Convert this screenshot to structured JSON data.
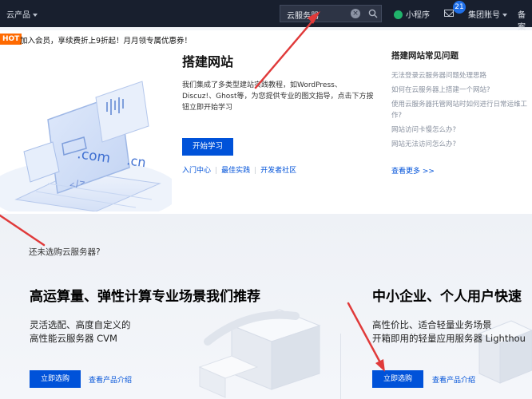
{
  "topbar": {
    "cloud_products": "云产品",
    "search_value": "云服务器",
    "mini_program": "小程序",
    "message_count": "21",
    "group_account": "集团账号",
    "beian": "备案"
  },
  "promo": {
    "hot": "HOT",
    "text": "加入会员，享续费折上9折起！月月领专属优惠券！"
  },
  "card": {
    "title": "搭建网站",
    "description": "我们集成了多类型建站实践教程，如WordPress、Discuz!、Ghost等，为您提供专业的图文指导，点击下方按钮立即开始学习",
    "start_button": "开始学习",
    "links": [
      "入门中心",
      "最佳实践",
      "开发者社区"
    ],
    "illustration_text": [
      ".com",
      ".cn",
      "</>"
    ],
    "faq_title": "搭建网站常见问题",
    "faq": [
      "无法登录云服务器问题处理思路",
      "如何在云服务器上搭建一个网站?",
      "使用云服务器托管网站时如何进行日常运维工作?",
      "网站访问卡慢怎么办?",
      "网站无法访问怎么办?"
    ],
    "more": "查看更多 >>"
  },
  "section": {
    "question": "还未选购云服务器?",
    "left": {
      "heading": "高运算量、弹性计算专业场景我们推荐",
      "line1": "灵活选配、高度自定义的",
      "line2": "高性能云服务器 CVM",
      "buy": "立即选购",
      "intro": "查看产品介绍"
    },
    "right": {
      "heading": "中小企业、个人用户快速",
      "line1": "高性价比、适合轻量业务场景",
      "line2": "开箱即用的轻量应用服务器 Lighthou",
      "buy": "立即选购",
      "intro": "查看产品介绍"
    }
  },
  "colors": {
    "brand_blue": "#0052d9",
    "nav_bg": "#181f2e",
    "hot_orange": "#ff6a00",
    "arrow_red": "#e03a3a"
  }
}
